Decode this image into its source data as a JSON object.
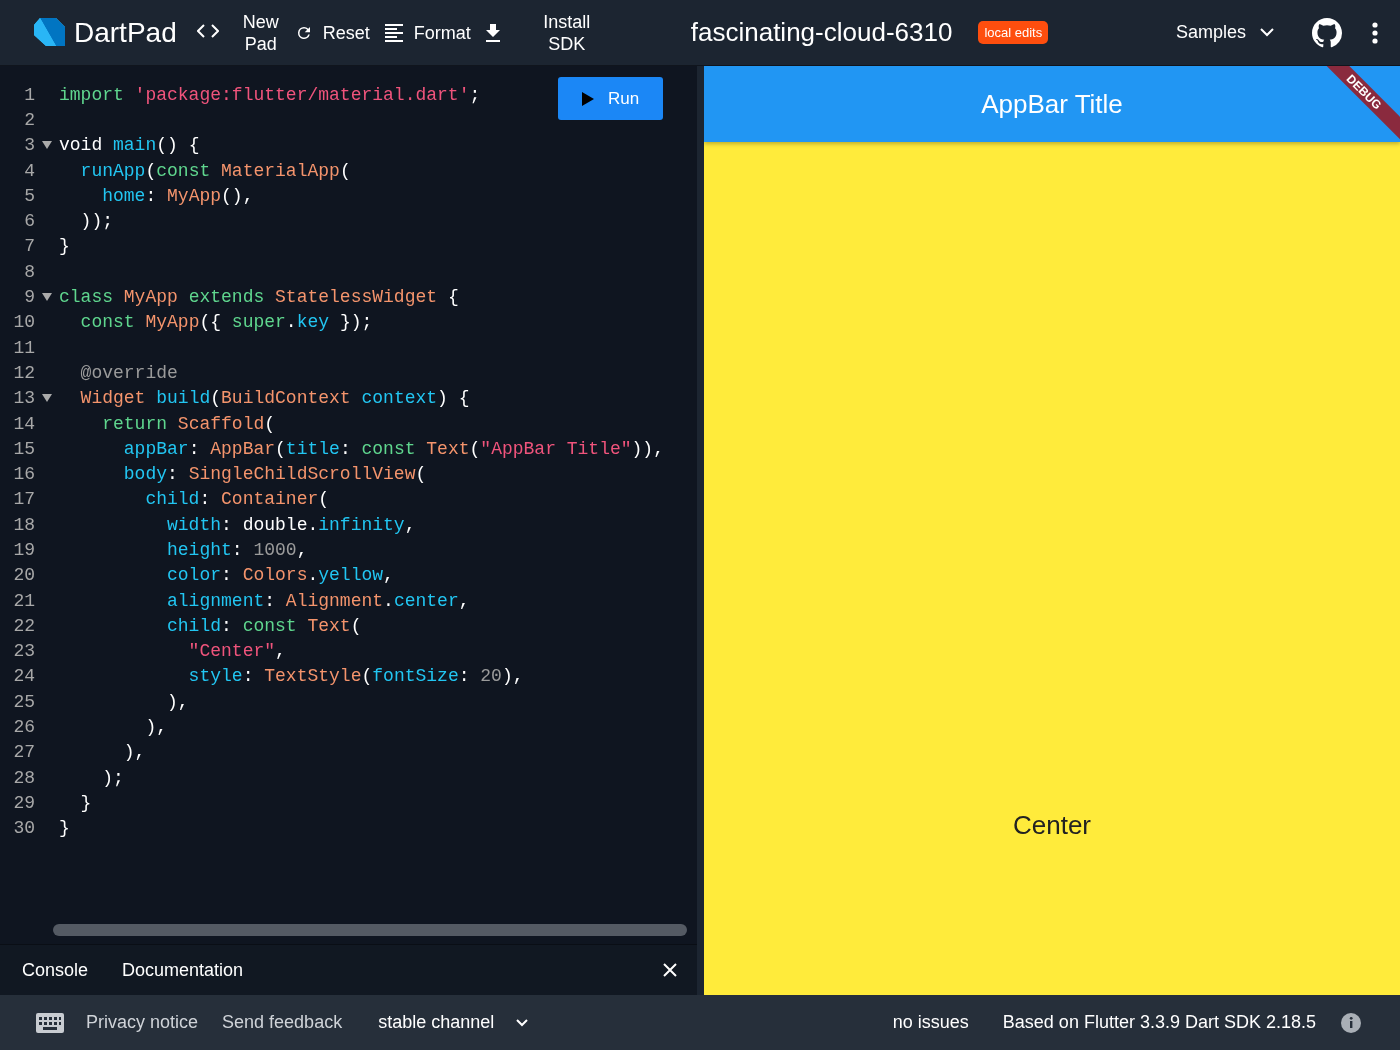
{
  "header": {
    "logo_text": "DartPad",
    "actions": [
      {
        "kind": "new",
        "label": "New Pad"
      },
      {
        "kind": "reset",
        "label": "Reset"
      },
      {
        "kind": "format",
        "label": "Format"
      },
      {
        "kind": "install",
        "label": "Install SDK"
      }
    ],
    "title": "fascinating-cloud-6310",
    "badge": "local edits",
    "samples": "Samples"
  },
  "editor": {
    "run_label": "Run",
    "lines": [
      {
        "number": "1",
        "foldable": false,
        "tokens": [
          {
            "kind": "kw",
            "text": "import"
          },
          {
            "kind": "str",
            "text": " 'package:flutter/material.dart'"
          },
          {
            "kind": "pl",
            "text": ";"
          }
        ]
      },
      {
        "number": "2",
        "foldable": false
      },
      {
        "number": "3",
        "foldable": true,
        "tokens": [
          {
            "kind": "pl",
            "text": "void "
          },
          {
            "kind": "fn",
            "text": "main"
          },
          {
            "kind": "pl",
            "text": "() {"
          }
        ]
      },
      {
        "number": "4",
        "foldable": false,
        "tokens": [
          {
            "kind": "fn",
            "text": "  runApp"
          },
          {
            "kind": "pl",
            "text": "("
          },
          {
            "kind": "kw",
            "text": "const"
          },
          {
            "kind": "ty",
            "text": " MaterialApp"
          },
          {
            "kind": "pl",
            "text": "("
          }
        ]
      },
      {
        "number": "5",
        "foldable": false,
        "tokens": [
          {
            "kind": "fn",
            "text": "    home"
          },
          {
            "kind": "pl",
            "text": ": "
          },
          {
            "kind": "ty",
            "text": "MyApp"
          },
          {
            "kind": "pl",
            "text": "(),"
          }
        ]
      },
      {
        "number": "6",
        "foldable": false,
        "tokens": [
          {
            "kind": "pl",
            "text": "  ));"
          }
        ]
      },
      {
        "number": "7",
        "foldable": false,
        "tokens": [
          {
            "kind": "pl",
            "text": "}"
          }
        ]
      },
      {
        "number": "8",
        "foldable": false
      },
      {
        "number": "9",
        "foldable": true,
        "tokens": [
          {
            "kind": "kw",
            "text": "class"
          },
          {
            "kind": "ty",
            "text": " MyApp"
          },
          {
            "kind": "kw",
            "text": " extends"
          },
          {
            "kind": "ty",
            "text": " StatelessWidget"
          },
          {
            "kind": "pl",
            "text": " {"
          }
        ]
      },
      {
        "number": "10",
        "foldable": false,
        "tokens": [
          {
            "kind": "kw",
            "text": "  const"
          },
          {
            "kind": "ty",
            "text": " MyApp"
          },
          {
            "kind": "pl",
            "text": "({ "
          },
          {
            "kind": "kw",
            "text": "super"
          },
          {
            "kind": "pl",
            "text": "."
          },
          {
            "kind": "fn",
            "text": "key"
          },
          {
            "kind": "pl",
            "text": " });"
          }
        ]
      },
      {
        "number": "11",
        "foldable": false
      },
      {
        "number": "12",
        "foldable": false,
        "tokens": [
          {
            "kind": "dim",
            "text": "  @override"
          }
        ]
      },
      {
        "number": "13",
        "foldable": true,
        "tokens": [
          {
            "kind": "ty",
            "text": "  Widget"
          },
          {
            "kind": "fn",
            "text": " build"
          },
          {
            "kind": "pl",
            "text": "("
          },
          {
            "kind": "ty",
            "text": "BuildContext"
          },
          {
            "kind": "fn",
            "text": " context"
          },
          {
            "kind": "pl",
            "text": ") {"
          }
        ]
      },
      {
        "number": "14",
        "foldable": false,
        "tokens": [
          {
            "kind": "kw",
            "text": "    return"
          },
          {
            "kind": "ty",
            "text": " Scaffold"
          },
          {
            "kind": "pl",
            "text": "("
          }
        ]
      },
      {
        "number": "15",
        "foldable": false,
        "tokens": [
          {
            "kind": "fn",
            "text": "      appBar"
          },
          {
            "kind": "pl",
            "text": ": "
          },
          {
            "kind": "ty",
            "text": "AppBar"
          },
          {
            "kind": "pl",
            "text": "("
          },
          {
            "kind": "fn",
            "text": "title"
          },
          {
            "kind": "pl",
            "text": ": "
          },
          {
            "kind": "kw",
            "text": "const"
          },
          {
            "kind": "ty",
            "text": " Text"
          },
          {
            "kind": "pl",
            "text": "("
          },
          {
            "kind": "str",
            "text": "\"AppBar Title\""
          },
          {
            "kind": "pl",
            "text": ")),"
          }
        ]
      },
      {
        "number": "16",
        "foldable": false,
        "tokens": [
          {
            "kind": "fn",
            "text": "      body"
          },
          {
            "kind": "pl",
            "text": ": "
          },
          {
            "kind": "ty",
            "text": "SingleChildScrollView"
          },
          {
            "kind": "pl",
            "text": "("
          }
        ]
      },
      {
        "number": "17",
        "foldable": false,
        "tokens": [
          {
            "kind": "fn",
            "text": "        child"
          },
          {
            "kind": "pl",
            "text": ": "
          },
          {
            "kind": "ty",
            "text": "Container"
          },
          {
            "kind": "pl",
            "text": "("
          }
        ]
      },
      {
        "number": "18",
        "foldable": false,
        "tokens": [
          {
            "kind": "fn",
            "text": "          width"
          },
          {
            "kind": "pl",
            "text": ": double."
          },
          {
            "kind": "fn",
            "text": "infinity"
          },
          {
            "kind": "pl",
            "text": ","
          }
        ]
      },
      {
        "number": "19",
        "foldable": false,
        "tokens": [
          {
            "kind": "fn",
            "text": "          height"
          },
          {
            "kind": "pl",
            "text": ": "
          },
          {
            "kind": "dim",
            "text": "1000"
          },
          {
            "kind": "pl",
            "text": ","
          }
        ]
      },
      {
        "number": "20",
        "foldable": false,
        "tokens": [
          {
            "kind": "fn",
            "text": "          color"
          },
          {
            "kind": "pl",
            "text": ": "
          },
          {
            "kind": "ty",
            "text": "Colors"
          },
          {
            "kind": "pl",
            "text": "."
          },
          {
            "kind": "fn",
            "text": "yellow"
          },
          {
            "kind": "pl",
            "text": ","
          }
        ]
      },
      {
        "number": "21",
        "foldable": false,
        "tokens": [
          {
            "kind": "fn",
            "text": "          alignment"
          },
          {
            "kind": "pl",
            "text": ": "
          },
          {
            "kind": "ty",
            "text": "Alignment"
          },
          {
            "kind": "pl",
            "text": "."
          },
          {
            "kind": "fn",
            "text": "center"
          },
          {
            "kind": "pl",
            "text": ","
          }
        ]
      },
      {
        "number": "22",
        "foldable": false,
        "tokens": [
          {
            "kind": "fn",
            "text": "          child"
          },
          {
            "kind": "pl",
            "text": ": "
          },
          {
            "kind": "kw",
            "text": "const"
          },
          {
            "kind": "ty",
            "text": " Text"
          },
          {
            "kind": "pl",
            "text": "("
          }
        ]
      },
      {
        "number": "23",
        "foldable": false,
        "tokens": [
          {
            "kind": "str",
            "text": "            \"Center\""
          },
          {
            "kind": "pl",
            "text": ","
          }
        ]
      },
      {
        "number": "24",
        "foldable": false,
        "tokens": [
          {
            "kind": "fn",
            "text": "            style"
          },
          {
            "kind": "pl",
            "text": ": "
          },
          {
            "kind": "ty",
            "text": "TextStyle"
          },
          {
            "kind": "pl",
            "text": "("
          },
          {
            "kind": "fn",
            "text": "fontSize"
          },
          {
            "kind": "pl",
            "text": ": "
          },
          {
            "kind": "dim",
            "text": "20"
          },
          {
            "kind": "pl",
            "text": "),"
          }
        ]
      },
      {
        "number": "25",
        "foldable": false,
        "tokens": [
          {
            "kind": "pl",
            "text": "          ),"
          }
        ]
      },
      {
        "number": "26",
        "foldable": false,
        "tokens": [
          {
            "kind": "pl",
            "text": "        ),"
          }
        ]
      },
      {
        "number": "27",
        "foldable": false,
        "tokens": [
          {
            "kind": "pl",
            "text": "      ),"
          }
        ]
      },
      {
        "number": "28",
        "foldable": false,
        "tokens": [
          {
            "kind": "pl",
            "text": "    );"
          }
        ]
      },
      {
        "number": "29",
        "foldable": false,
        "tokens": [
          {
            "kind": "pl",
            "text": "  }"
          }
        ]
      },
      {
        "number": "30",
        "foldable": false,
        "tokens": [
          {
            "kind": "pl",
            "text": "}"
          }
        ]
      }
    ]
  },
  "panel_tabs": [
    "Console",
    "Documentation"
  ],
  "preview": {
    "appbar_title": "AppBar Title",
    "banner": "DEBUG",
    "body_text": "Center"
  },
  "footer": {
    "privacy": "Privacy notice",
    "feedback": "Send feedback",
    "channel": "stable channel",
    "issues": "no issues",
    "version": "Based on Flutter 3.3.9 Dart SDK 2.18.5"
  }
}
